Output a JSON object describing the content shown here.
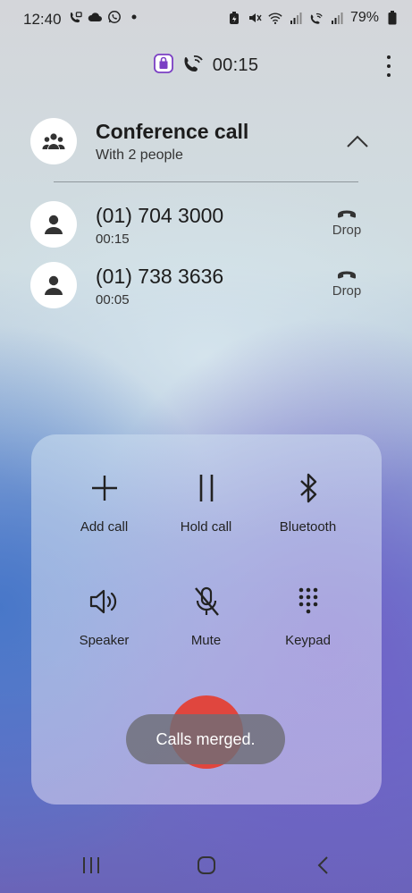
{
  "status_bar": {
    "time": "12:40",
    "battery": "79%"
  },
  "call": {
    "timer": "00:15"
  },
  "conference": {
    "title": "Conference call",
    "subtitle": "With 2 people"
  },
  "participants": [
    {
      "number": "(01) 704 3000",
      "duration": "00:15",
      "drop_label": "Drop"
    },
    {
      "number": "(01) 738 3636",
      "duration": "00:05",
      "drop_label": "Drop"
    }
  ],
  "controls": {
    "add_call": "Add call",
    "hold_call": "Hold call",
    "bluetooth": "Bluetooth",
    "speaker": "Speaker",
    "mute": "Mute",
    "keypad": "Keypad"
  },
  "toast": "Calls merged.",
  "colors": {
    "end_call": "#e0463e",
    "recorder_accent": "#7b3fc4"
  }
}
